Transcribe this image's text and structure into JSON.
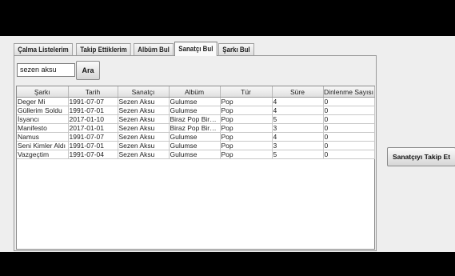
{
  "tabs": [
    {
      "label": "Çalma Listelerim"
    },
    {
      "label": "Takip Ettiklerim"
    },
    {
      "label": "Albüm Bul"
    },
    {
      "label": "Sanatçı Bul"
    },
    {
      "label": "Şarkı Bul"
    }
  ],
  "active_tab": "Sanatçı Bul",
  "search": {
    "value": "sezen aksu",
    "button_label": "Ara"
  },
  "table": {
    "columns": [
      "Şarkı",
      "Tarih",
      "Sanatçı",
      "Albüm",
      "Tür",
      "Süre",
      "Dinlenme Sayısı"
    ],
    "rows": [
      [
        "Deger Mi",
        "1991-07-07",
        "Sezen Aksu",
        "Gulumse",
        "Pop",
        "4",
        "0"
      ],
      [
        "Güllerim Soldu",
        "1991-07-01",
        "Sezen Aksu",
        "Gulumse",
        "Pop",
        "4",
        "0"
      ],
      [
        "İsyancı",
        "2017-01-10",
        "Sezen Aksu",
        "Biraz Pop Biraz S...",
        "Pop",
        "5",
        "0"
      ],
      [
        "Manifesto",
        "2017-01-01",
        "Sezen Aksu",
        "Biraz Pop Biraz S...",
        "Pop",
        "3",
        "0"
      ],
      [
        "Namus",
        "1991-07-07",
        "Sezen Aksu",
        "Gulumse",
        "Pop",
        "4",
        "0"
      ],
      [
        "Seni Kimler Aldı",
        "1991-07-01",
        "Sezen Aksu",
        "Gulumse",
        "Pop",
        "3",
        "0"
      ],
      [
        "Vazgeçtim",
        "1991-07-04",
        "Sezen Aksu",
        "Gulumse",
        "Pop",
        "5",
        "0"
      ]
    ]
  },
  "follow_button_label": "Sanatçıyı Takip Et"
}
